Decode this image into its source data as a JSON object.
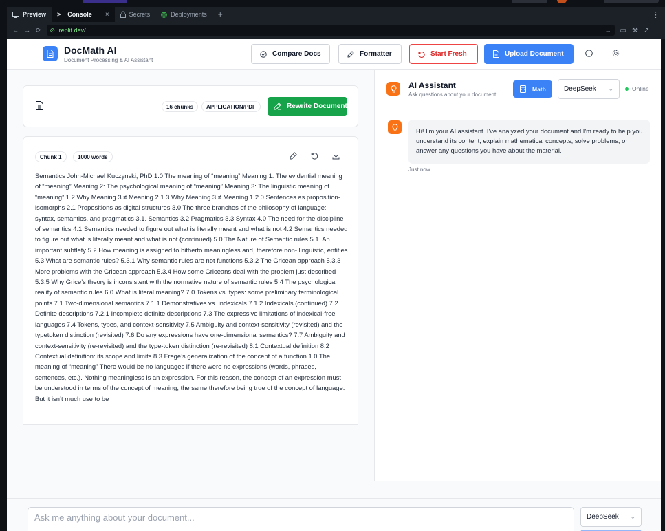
{
  "ide": {
    "tabs": [
      {
        "label": "Preview",
        "icon": "monitor-icon"
      },
      {
        "label": "Console",
        "icon": "terminal-icon"
      },
      {
        "label": "Secrets",
        "icon": "lock-icon"
      },
      {
        "label": "Deployments",
        "icon": "globe-icon"
      }
    ],
    "close_glyph": "×",
    "plus_glyph": "+",
    "url_prefix": ".replit.dev",
    "url_path": "/"
  },
  "header": {
    "title": "DocMath AI",
    "subtitle": "Document Processing & AI Assistant",
    "compare_label": "Compare Docs",
    "formatter_label": "Formatter",
    "start_fresh_label": "Start Fresh",
    "upload_label": "Upload Document"
  },
  "document": {
    "chunks_badge": "16 chunks",
    "type_badge": "APPLICATION/PDF",
    "rewrite_label": "Rewrite Document"
  },
  "chunk": {
    "label": "Chunk 1",
    "words": "1000 words",
    "text": "Semantics John-Michael Kuczynski, PhD 1.0 The meaning of “meaning” Meaning 1: The evidential meaning of “meaning” Meaning 2: The psychological meaning of “meaning” Meaning 3: The linguistic meaning of “meaning” 1.2 Why Meaning 3 ≠ Meaning 2 1.3 Why Meaning 3 ≠ Meaning 1 2.0 Sentences as proposition-isomorphs 2.1 Propositions as digital structures 3.0 The three branches of the philosophy of language: syntax, semantics, and pragmatics 3.1. Semantics 3.2 Pragmatics 3.3 Syntax 4.0 The need for the discipline of semantics 4.1 Semantics needed to figure out what is literally meant and what is not 4.2 Semantics needed to figure out what is literally meant and what is not (continued) 5.0 The Nature of Semantic rules 5.1. An important subtlety 5.2 How meaning is assigned to hitherto meaningless and, therefore non- linguistic, entities 5.3 What are semantic rules? 5.3.1 Why semantic rules are not functions 5.3.2 The Gricean approach 5.3.3 More problems with the Gricean approach 5.3.4 How some Griceans deal with the problem just described 5.3.5 Why Grice’s theory is inconsistent with the normative nature of semantic rules 5.4 The psychological reality of semantic rules 6.0 What is literal meaning? 7.0 Tokens vs. types: some preliminary terminological points 7.1 Two-dimensional semantics 7.1.1 Demonstratives vs. indexicals 7.1.2 Indexicals (continued) 7.2 Definite descriptions 7.2.1 Incomplete definite descriptions 7.3 The expressive limitations of indexical-free languages 7.4 Tokens, types, and context-sensitivity 7.5 Ambiguity and context-sensitivity (revisited) and the typetoken distinction (revisited) 7.6 Do any expressions have one-dimensional semantics? 7.7 Ambiguity and context-sensitivity (re-revisited) and the type-token distinction (re-revisited) 8.1 Contextual definition 8.2 Contextual definition: its scope and limits 8.3 Frege’s generalization of the concept of a function 1.0 The meaning of “meaning” There would be no languages if there were no expressions (words, phrases, sentences, etc.). Nothing meaningless is an expression. For this reason, the concept of an expression must be understood in terms of the concept of meaning, the same therefore being true of the concept of language. But it isn’t much use to be"
  },
  "assistant": {
    "title": "AI Assistant",
    "subtitle": "Ask questions about your document",
    "math_label": "Math",
    "model": "DeepSeek",
    "status": "Online",
    "message": "Hi! I'm your AI assistant. I've analyzed your document and I'm ready to help you understand its content, explain mathematical concepts, solve problems, or answer any questions you have about the material.",
    "timestamp": "Just now"
  },
  "composer": {
    "placeholder": "Ask me anything about your document...",
    "model": "DeepSeek"
  },
  "colors": {
    "primary": "#3b82f6",
    "success": "#16a34a",
    "danger": "#dc2626",
    "accent": "#f97316",
    "online": "#22c55e"
  }
}
